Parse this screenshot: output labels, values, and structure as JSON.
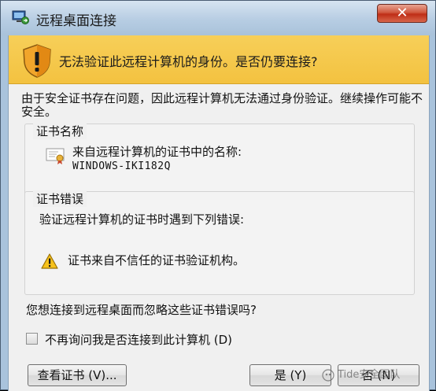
{
  "window": {
    "title": "远程桌面连接",
    "close_label": "✕"
  },
  "banner": {
    "message": "无法验证此远程计算机的身份。是否仍要连接?"
  },
  "description": "由于安全证书存在问题，因此远程计算机无法通过身份验证。继续操作可能不安全。",
  "cert_group": {
    "legend": "证书名称",
    "label": "来自远程计算机的证书中的名称:",
    "value": "WINDOWS-IKI182Q"
  },
  "error_group": {
    "legend": "证书错误",
    "label": "验证远程计算机的证书时遇到下列错误:",
    "item": "证书来自不信任的证书验证机构。"
  },
  "question": "您想连接到远程桌面而忽略这些证书错误吗?",
  "checkbox": {
    "label": "不再询问我是否连接到此计算机 (D)",
    "checked": false
  },
  "buttons": {
    "view_cert": "查看证书 (V)...",
    "yes": "是 (Y)",
    "no": "否 (N)"
  },
  "watermark": "Tide安全团队",
  "colors": {
    "banner": "#f3c240",
    "title_bar": "#b7cde3",
    "close_button": "#c7361e"
  }
}
